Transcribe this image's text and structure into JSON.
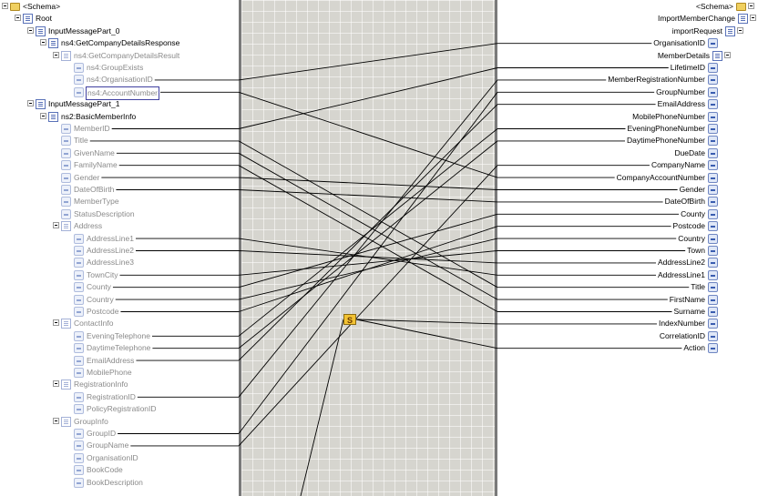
{
  "source_schema": {
    "root_label": "<Schema>",
    "nodes": [
      {
        "label": "Root",
        "depth": 1,
        "kind": "record",
        "gray": false,
        "expander": true
      },
      {
        "label": "InputMessagePart_0",
        "depth": 2,
        "kind": "record",
        "gray": false,
        "expander": true
      },
      {
        "label": "ns4:GetCompanyDetailsResponse",
        "depth": 3,
        "kind": "record",
        "gray": false,
        "expander": true
      },
      {
        "label": "ns4:GetCompanyDetailsResult",
        "depth": 4,
        "kind": "record",
        "gray": true,
        "expander": true
      },
      {
        "label": "ns4:GroupExists",
        "depth": 5,
        "kind": "field",
        "gray": true
      },
      {
        "label": "ns4:OrganisationID",
        "depth": 5,
        "kind": "field",
        "gray": true
      },
      {
        "label": "ns4:AccountNumber",
        "depth": 5,
        "kind": "field",
        "gray": true,
        "selected": true
      },
      {
        "label": "InputMessagePart_1",
        "depth": 2,
        "kind": "record",
        "gray": false,
        "expander": true
      },
      {
        "label": "ns2:BasicMemberInfo",
        "depth": 3,
        "kind": "record",
        "gray": false,
        "expander": true
      },
      {
        "label": "MemberID",
        "depth": 4,
        "kind": "field",
        "gray": true
      },
      {
        "label": "Title",
        "depth": 4,
        "kind": "field",
        "gray": true
      },
      {
        "label": "GivenName",
        "depth": 4,
        "kind": "field",
        "gray": true
      },
      {
        "label": "FamilyName",
        "depth": 4,
        "kind": "field",
        "gray": true
      },
      {
        "label": "Gender",
        "depth": 4,
        "kind": "field",
        "gray": true
      },
      {
        "label": "DateOfBirth",
        "depth": 4,
        "kind": "field",
        "gray": true
      },
      {
        "label": "MemberType",
        "depth": 4,
        "kind": "field",
        "gray": true
      },
      {
        "label": "StatusDescription",
        "depth": 4,
        "kind": "field",
        "gray": true
      },
      {
        "label": "Address",
        "depth": 4,
        "kind": "record",
        "gray": true,
        "expander": true
      },
      {
        "label": "AddressLine1",
        "depth": 5,
        "kind": "field",
        "gray": true
      },
      {
        "label": "AddressLine2",
        "depth": 5,
        "kind": "field",
        "gray": true
      },
      {
        "label": "AddressLine3",
        "depth": 5,
        "kind": "field",
        "gray": true
      },
      {
        "label": "TownCity",
        "depth": 5,
        "kind": "field",
        "gray": true
      },
      {
        "label": "County",
        "depth": 5,
        "kind": "field",
        "gray": true
      },
      {
        "label": "Country",
        "depth": 5,
        "kind": "field",
        "gray": true
      },
      {
        "label": "Postcode",
        "depth": 5,
        "kind": "field",
        "gray": true
      },
      {
        "label": "ContactInfo",
        "depth": 4,
        "kind": "record",
        "gray": true,
        "expander": true
      },
      {
        "label": "EveningTelephone",
        "depth": 5,
        "kind": "field",
        "gray": true
      },
      {
        "label": "DaytimeTelephone",
        "depth": 5,
        "kind": "field",
        "gray": true
      },
      {
        "label": "EmailAddress",
        "depth": 5,
        "kind": "field",
        "gray": true
      },
      {
        "label": "MobilePhone",
        "depth": 5,
        "kind": "field",
        "gray": true
      },
      {
        "label": "RegistrationInfo",
        "depth": 4,
        "kind": "record",
        "gray": true,
        "expander": true
      },
      {
        "label": "RegistrationID",
        "depth": 5,
        "kind": "field",
        "gray": true
      },
      {
        "label": "PolicyRegistrationID",
        "depth": 5,
        "kind": "field",
        "gray": true
      },
      {
        "label": "GroupInfo",
        "depth": 4,
        "kind": "record",
        "gray": true,
        "expander": true
      },
      {
        "label": "GroupID",
        "depth": 5,
        "kind": "field",
        "gray": true
      },
      {
        "label": "GroupName",
        "depth": 5,
        "kind": "field",
        "gray": true
      },
      {
        "label": "OrganisationID",
        "depth": 5,
        "kind": "field",
        "gray": true
      },
      {
        "label": "BookCode",
        "depth": 5,
        "kind": "field",
        "gray": true
      },
      {
        "label": "BookDescription",
        "depth": 5,
        "kind": "field",
        "gray": true
      }
    ]
  },
  "destination_schema": {
    "root_label": "<Schema>",
    "nodes": [
      {
        "label": "ImportMemberChange",
        "kind": "record",
        "expander": true
      },
      {
        "label": "importRequest",
        "kind": "record",
        "expander": true
      },
      {
        "label": "OrganisationID",
        "kind": "field"
      },
      {
        "label": "MemberDetails",
        "kind": "record",
        "expander": true
      },
      {
        "label": "LifetimeID",
        "kind": "field"
      },
      {
        "label": "MemberRegistrationNumber",
        "kind": "field"
      },
      {
        "label": "GroupNumber",
        "kind": "field"
      },
      {
        "label": "EmailAddress",
        "kind": "field"
      },
      {
        "label": "MobilePhoneNumber",
        "kind": "field"
      },
      {
        "label": "EveningPhoneNumber",
        "kind": "field"
      },
      {
        "label": "DaytimePhoneNumber",
        "kind": "field"
      },
      {
        "label": "DueDate",
        "kind": "field"
      },
      {
        "label": "CompanyName",
        "kind": "field"
      },
      {
        "label": "CompanyAccountNumber",
        "kind": "field"
      },
      {
        "label": "Gender",
        "kind": "field"
      },
      {
        "label": "DateOfBirth",
        "kind": "field"
      },
      {
        "label": "County",
        "kind": "field"
      },
      {
        "label": "Postcode",
        "kind": "field"
      },
      {
        "label": "Country",
        "kind": "field"
      },
      {
        "label": "Town",
        "kind": "field"
      },
      {
        "label": "AddressLine2",
        "kind": "field"
      },
      {
        "label": "AddressLine1",
        "kind": "field"
      },
      {
        "label": "Title",
        "kind": "field"
      },
      {
        "label": "FirstName",
        "kind": "field"
      },
      {
        "label": "Surname",
        "kind": "field"
      },
      {
        "label": "IndexNumber",
        "kind": "field"
      },
      {
        "label": "CorrelationID",
        "kind": "field"
      },
      {
        "label": "Action",
        "kind": "field"
      }
    ]
  },
  "functoid": {
    "symbol": "S",
    "name": "string-functoid"
  },
  "links": [
    {
      "from": "ns4:OrganisationID",
      "to": "OrganisationID"
    },
    {
      "from": "ns4:AccountNumber",
      "to": "CompanyAccountNumber"
    },
    {
      "from": "MemberID",
      "to": "LifetimeID"
    },
    {
      "from": "Title",
      "to": "Title"
    },
    {
      "from": "GivenName",
      "to": "FirstName"
    },
    {
      "from": "FamilyName",
      "to": "Surname"
    },
    {
      "from": "Gender",
      "to": "Gender"
    },
    {
      "from": "DateOfBirth",
      "to": "DateOfBirth"
    },
    {
      "from": "AddressLine1",
      "to": "AddressLine1"
    },
    {
      "from": "AddressLine2",
      "to": "AddressLine2"
    },
    {
      "from": "TownCity",
      "to": "Town"
    },
    {
      "from": "County",
      "to": "County"
    },
    {
      "from": "Country",
      "to": "Country"
    },
    {
      "from": "Postcode",
      "to": "Postcode"
    },
    {
      "from": "EveningTelephone",
      "to": "EveningPhoneNumber"
    },
    {
      "from": "DaytimeTelephone",
      "to": "DaytimePhoneNumber"
    },
    {
      "from": "EmailAddress",
      "to": "EmailAddress"
    },
    {
      "from": "RegistrationID",
      "to": "MemberRegistrationNumber"
    },
    {
      "from": "GroupID",
      "to": "GroupNumber"
    },
    {
      "from": "GroupName",
      "to": "CompanyName"
    }
  ]
}
